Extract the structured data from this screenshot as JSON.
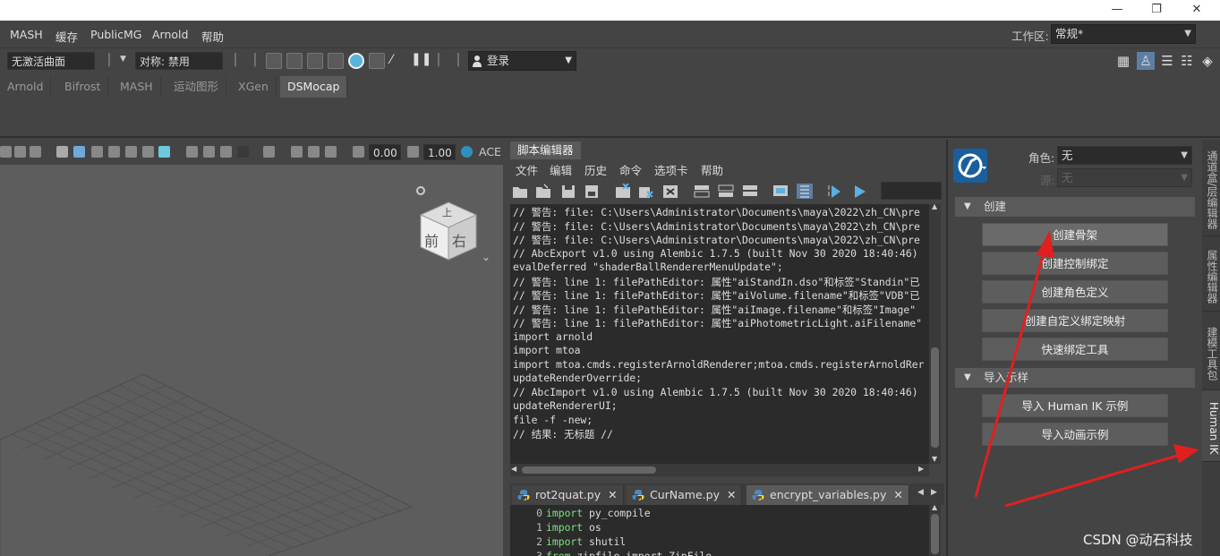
{
  "window": {
    "min": "—",
    "restore": "❐",
    "close": "✕"
  },
  "menubar": {
    "items": [
      "MASH",
      "缓存",
      "PublicMG",
      "Arnold",
      "帮助"
    ],
    "workspace_label": "工作区:",
    "workspace_value": "常规*"
  },
  "toolbar": {
    "surface_field": "无激活曲面",
    "symmetry_field": "对称: 禁用",
    "login_label": "登录"
  },
  "shelf": {
    "tabs": [
      "Arnold",
      "Bifrost",
      "MASH",
      "运动图形",
      "XGen",
      "DSMocap"
    ],
    "active_tab": "DSMocap"
  },
  "viewport": {
    "value_a": "0.00",
    "value_b": "1.00",
    "colorspace": "ACE",
    "viewcube_top": "上",
    "viewcube_front": "前",
    "viewcube_right": "右"
  },
  "script_editor": {
    "title": "脚本编辑器",
    "menu": [
      "文件",
      "编辑",
      "历史",
      "命令",
      "选项卡",
      "帮助"
    ],
    "output_lines": [
      "// 警告: file: C:\\Users\\Administrator\\Documents\\maya\\2022\\zh_CN\\pre",
      "// 警告: file: C:\\Users\\Administrator\\Documents\\maya\\2022\\zh_CN\\pre",
      "// 警告: file: C:\\Users\\Administrator\\Documents\\maya\\2022\\zh_CN\\pre",
      "// AbcExport v1.0 using Alembic 1.7.5 (built Nov 30 2020 18:40:46)",
      "evalDeferred \"shaderBallRendererMenuUpdate\";",
      "// 警告: line 1: filePathEditor: 属性\"aiStandIn.dso\"和标签\"Standin\"已",
      "// 警告: line 1: filePathEditor: 属性\"aiVolume.filename\"和标签\"VDB\"已",
      "// 警告: line 1: filePathEditor: 属性\"aiImage.filename\"和标签\"Image\"",
      "// 警告: line 1: filePathEditor: 属性\"aiPhotometricLight.aiFilename\"",
      "import arnold",
      "import mtoa",
      "import mtoa.cmds.registerArnoldRenderer;mtoa.cmds.registerArnoldRer",
      "updateRenderOverride;",
      "// AbcImport v1.0 using Alembic 1.7.5 (built Nov 30 2020 18:40:46)",
      "updateRendererUI;",
      "file -f -new;",
      "// 结果: 无标题 //"
    ],
    "tabs": [
      "rot2quat.py",
      "CurName.py",
      "encrypt_variables.py"
    ],
    "active_tab": "encrypt_variables.py",
    "tab_close": "✕",
    "code_lines": [
      {
        "num": "0",
        "kw": "import",
        "rest": " py_compile"
      },
      {
        "num": "1",
        "kw": "import",
        "rest": " os"
      },
      {
        "num": "2",
        "kw": "import",
        "rest": " shutil"
      },
      {
        "num": "3",
        "kw": "from",
        "rest": " zipfile import ZipFile"
      }
    ]
  },
  "human_ik": {
    "character_label": "角色:",
    "character_value": "无",
    "source_label": "源:",
    "source_value": "无",
    "section_create": "创建",
    "create_buttons": [
      "创建骨架",
      "创建控制绑定",
      "创建角色定义",
      "创建自定义绑定映射",
      "快速绑定工具"
    ],
    "section_import": "导入示样",
    "import_buttons": [
      "导入 Human IK 示例",
      "导入动画示例"
    ]
  },
  "side_tabs": [
    "通道盒/层编辑器",
    "属性编辑器",
    "建模工具包",
    "Human IK"
  ],
  "side_active": "Human IK",
  "watermark": "CSDN @动石科技",
  "colors": {
    "annotation_arrow": "#e02020",
    "hik_logo": "#1a5f9c",
    "code_keyword": "#7fe07f"
  }
}
